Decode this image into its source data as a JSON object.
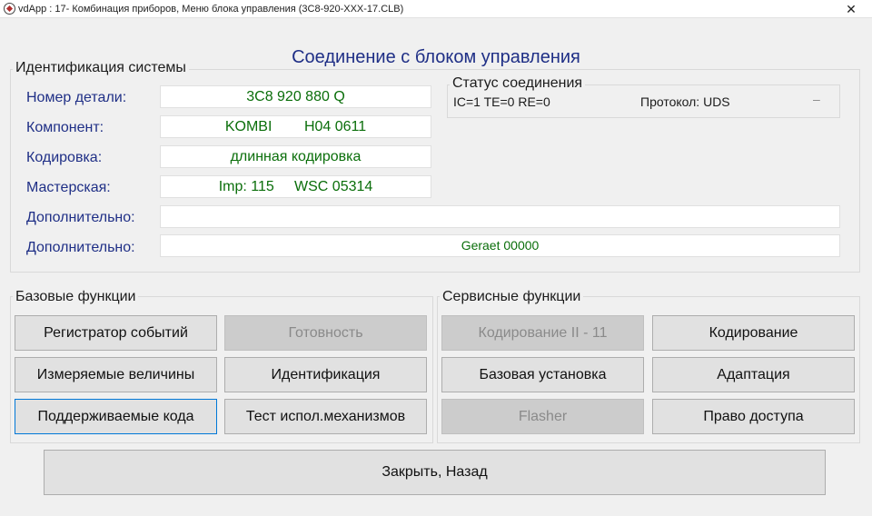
{
  "window": {
    "title": "vdApp : 17- Комбинация приборов,  Меню блока управления (3C8-920-XXX-17.CLB)",
    "close_glyph": "✕"
  },
  "heading": "Соединение с блоком управления",
  "identification": {
    "group_label": "Идентификация системы",
    "fields": [
      {
        "label": "Номер детали:",
        "value": "3C8 920 880 Q"
      },
      {
        "label": "Компонент:",
        "value": "KOMBI        H04 0611"
      },
      {
        "label": "Кодировка:",
        "value": "длинная кодировка"
      },
      {
        "label": "Мастерская:",
        "value": "Imp: 115     WSC 05314"
      },
      {
        "label": "Дополнительно:",
        "value": ""
      },
      {
        "label": "Дополнительно:",
        "value": "Geraet 00000"
      }
    ]
  },
  "status": {
    "group_label": "Статус соединения",
    "counters": "IC=1  TE=0   RE=0",
    "protocol": "Протокол: UDS",
    "indicator": "–"
  },
  "basic_functions": {
    "group_label": "Базовые функции",
    "buttons": [
      {
        "label": "Регистратор событий",
        "enabled": true
      },
      {
        "label": "Готовность",
        "enabled": false
      },
      {
        "label": "Измеряемые величины",
        "enabled": true
      },
      {
        "label": "Идентификация",
        "enabled": true
      },
      {
        "label": "Поддерживаемые кода",
        "enabled": true,
        "focused": true
      },
      {
        "label": "Тест испол.механизмов",
        "enabled": true
      }
    ]
  },
  "service_functions": {
    "group_label": "Сервисные функции",
    "buttons": [
      {
        "label": "Кодирование II - 11",
        "enabled": false
      },
      {
        "label": "Кодирование",
        "enabled": true
      },
      {
        "label": "Базовая установка",
        "enabled": true
      },
      {
        "label": "Адаптация",
        "enabled": true
      },
      {
        "label": "Flasher",
        "enabled": false
      },
      {
        "label": "Право доступа",
        "enabled": true
      }
    ]
  },
  "close_button": "Закрыть, Назад"
}
